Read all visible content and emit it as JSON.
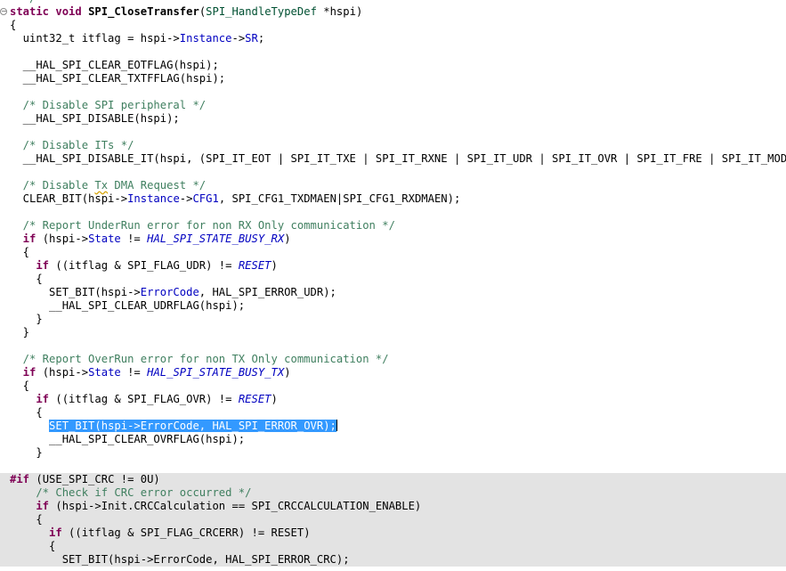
{
  "editor": {
    "highlight_color": "#3399ff",
    "inactive_region_color": "#e3e3e3",
    "colors": {
      "keyword": "#7f0055",
      "type": "#005032",
      "field": "#0000c0",
      "comment": "#3f7f5f"
    },
    "lines": [
      {
        "t": [
          [
            "cm",
            "  */"
          ]
        ]
      },
      {
        "fold": true,
        "t": [
          [
            "kw",
            "static"
          ],
          [
            "",
            " "
          ],
          [
            "kw",
            "void"
          ],
          [
            "",
            " "
          ],
          [
            "fn",
            "SPI_CloseTransfer"
          ],
          [
            "",
            "("
          ],
          [
            "ty",
            "SPI_HandleTypeDef"
          ],
          [
            "",
            " *hspi)"
          ]
        ]
      },
      {
        "t": [
          [
            "",
            "{"
          ]
        ]
      },
      {
        "t": [
          [
            "",
            "  uint32_t itflag = hspi->"
          ],
          [
            "fl",
            "Instance"
          ],
          [
            "",
            "->"
          ],
          [
            "fl",
            "SR"
          ],
          [
            "",
            ";"
          ]
        ]
      },
      {
        "t": []
      },
      {
        "t": [
          [
            "",
            "  __HAL_SPI_CLEAR_EOTFLAG(hspi);"
          ]
        ]
      },
      {
        "t": [
          [
            "",
            "  __HAL_SPI_CLEAR_TXTFFLAG(hspi);"
          ]
        ]
      },
      {
        "t": []
      },
      {
        "t": [
          [
            "cm",
            "  /* Disable SPI peripheral */"
          ]
        ]
      },
      {
        "t": [
          [
            "",
            "  __HAL_SPI_DISABLE(hspi);"
          ]
        ]
      },
      {
        "t": []
      },
      {
        "t": [
          [
            "cm",
            "  /* Disable ITs */"
          ]
        ]
      },
      {
        "t": [
          [
            "",
            "  __HAL_SPI_DISABLE_IT(hspi, (SPI_IT_EOT | SPI_IT_TXE | SPI_IT_RXNE | SPI_IT_UDR | SPI_IT_OVR | SPI_IT_FRE | SPI_IT_MODF));"
          ]
        ]
      },
      {
        "t": []
      },
      {
        "t": [
          [
            "cm",
            "  /* Disable "
          ],
          [
            "cm sq",
            "Tx"
          ],
          [
            "cm",
            " DMA Request */"
          ]
        ]
      },
      {
        "t": [
          [
            "",
            "  CLEAR_BIT(hspi->"
          ],
          [
            "fl",
            "Instance"
          ],
          [
            "",
            "->"
          ],
          [
            "fl",
            "CFG1"
          ],
          [
            "",
            ", SPI_CFG1_TXDMAEN|SPI_CFG1_RXDMAEN);"
          ]
        ]
      },
      {
        "t": []
      },
      {
        "t": [
          [
            "cm",
            "  /* Report UnderRun error for non RX Only communication */"
          ]
        ]
      },
      {
        "t": [
          [
            "kw",
            "  if"
          ],
          [
            "",
            " (hspi->"
          ],
          [
            "fl",
            "State"
          ],
          [
            "",
            " != "
          ],
          [
            "mc",
            "HAL_SPI_STATE_BUSY_RX"
          ],
          [
            "",
            ")"
          ]
        ]
      },
      {
        "t": [
          [
            "",
            "  {"
          ]
        ]
      },
      {
        "t": [
          [
            "kw",
            "    if"
          ],
          [
            "",
            " ((itflag & SPI_FLAG_UDR) != "
          ],
          [
            "mc",
            "RESET"
          ],
          [
            "",
            ")"
          ]
        ]
      },
      {
        "t": [
          [
            "",
            "    {"
          ]
        ]
      },
      {
        "t": [
          [
            "",
            "      SET_BIT(hspi->"
          ],
          [
            "fl",
            "ErrorCode"
          ],
          [
            "",
            ", HAL_SPI_ERROR_UDR);"
          ]
        ]
      },
      {
        "t": [
          [
            "",
            "      __HAL_SPI_CLEAR_UDRFLAG(hspi);"
          ]
        ]
      },
      {
        "t": [
          [
            "",
            "    }"
          ]
        ]
      },
      {
        "t": [
          [
            "",
            "  }"
          ]
        ]
      },
      {
        "t": []
      },
      {
        "t": [
          [
            "cm",
            "  /* Report OverRun error for non TX Only communication */"
          ]
        ]
      },
      {
        "t": [
          [
            "kw",
            "  if"
          ],
          [
            "",
            " (hspi->"
          ],
          [
            "fl",
            "State"
          ],
          [
            "",
            " != "
          ],
          [
            "mc",
            "HAL_SPI_STATE_BUSY_TX"
          ],
          [
            "",
            ")"
          ]
        ]
      },
      {
        "t": [
          [
            "",
            "  {"
          ]
        ]
      },
      {
        "t": [
          [
            "kw",
            "    if"
          ],
          [
            "",
            " ((itflag & SPI_FLAG_OVR) != "
          ],
          [
            "mc",
            "RESET"
          ],
          [
            "",
            ")"
          ]
        ]
      },
      {
        "t": [
          [
            "",
            "    {"
          ]
        ]
      },
      {
        "active": true,
        "t": [
          [
            "",
            "      "
          ],
          [
            "sel",
            "SET_BIT(hspi->ErrorCode, HAL_SPI_ERROR_OVR);"
          ],
          [
            "cur",
            ""
          ]
        ]
      },
      {
        "t": [
          [
            "",
            "      __HAL_SPI_CLEAR_OVRFLAG(hspi);"
          ]
        ]
      },
      {
        "t": [
          [
            "",
            "    }"
          ]
        ]
      },
      {
        "t": []
      },
      {
        "inactive": true,
        "t": [
          [
            "pp",
            "#if"
          ],
          [
            "",
            " (USE_SPI_CRC != 0U)"
          ]
        ]
      },
      {
        "inactive": true,
        "t": [
          [
            "cm",
            "    /* Check if CRC error occurred */"
          ]
        ]
      },
      {
        "inactive": true,
        "t": [
          [
            "kw",
            "    if"
          ],
          [
            "",
            " (hspi->Init.CRCCalculation == SPI_CRCCALCULATION_ENABLE)"
          ]
        ]
      },
      {
        "inactive": true,
        "t": [
          [
            "",
            "    {"
          ]
        ]
      },
      {
        "inactive": true,
        "t": [
          [
            "kw",
            "      if"
          ],
          [
            "",
            " ((itflag & SPI_FLAG_CRCERR) != RESET)"
          ]
        ]
      },
      {
        "inactive": true,
        "t": [
          [
            "",
            "      {"
          ]
        ]
      },
      {
        "inactive": true,
        "t": [
          [
            "",
            "        SET_BIT(hspi->ErrorCode, HAL_SPI_ERROR_CRC);"
          ]
        ]
      }
    ]
  }
}
